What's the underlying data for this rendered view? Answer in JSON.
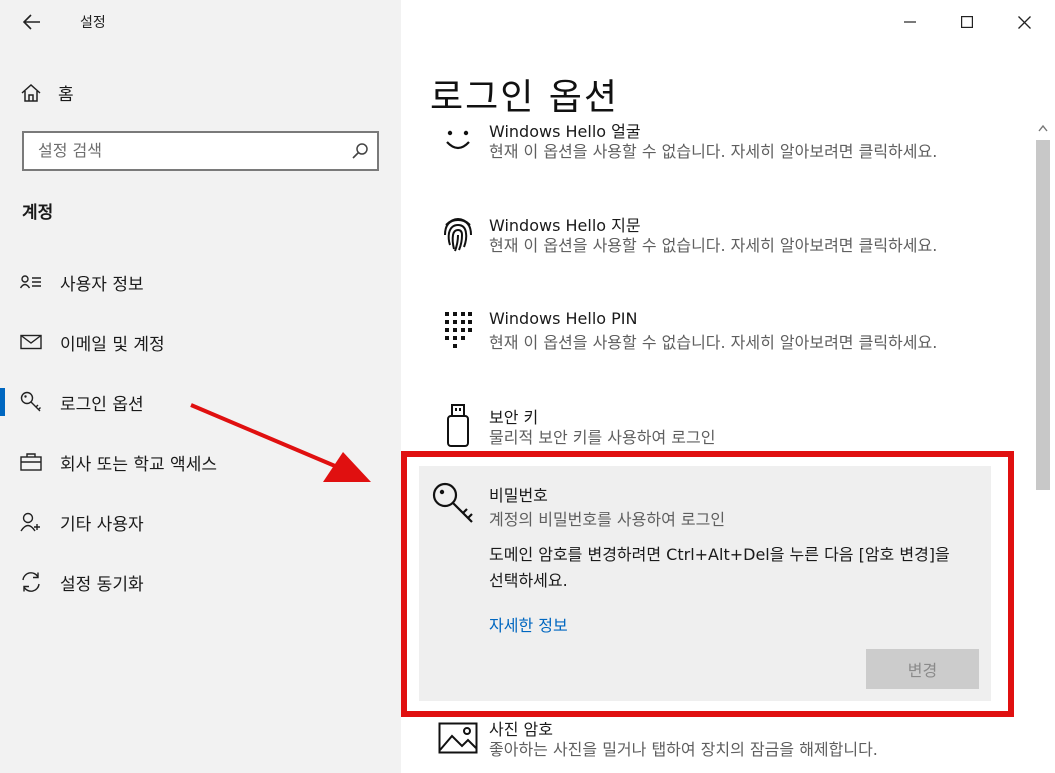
{
  "window": {
    "app_title": "설정"
  },
  "sidebar": {
    "home_label": "홈",
    "search_placeholder": "설정 검색",
    "section_title": "계정",
    "items": [
      {
        "label": "사용자 정보",
        "icon": "user-info-icon"
      },
      {
        "label": "이메일 및 계정",
        "icon": "mail-icon"
      },
      {
        "label": "로그인 옵션",
        "icon": "key-icon",
        "selected": true
      },
      {
        "label": "회사 또는 학교 액세스",
        "icon": "briefcase-icon"
      },
      {
        "label": "기타 사용자",
        "icon": "add-user-icon"
      },
      {
        "label": "설정 동기화",
        "icon": "sync-icon"
      }
    ]
  },
  "main": {
    "page_title": "로그인 옵션",
    "options": [
      {
        "title": "Windows Hello 얼굴",
        "desc": "현재 이 옵션을 사용할 수 없습니다. 자세히 알아보려면 클릭하세요."
      },
      {
        "title": "Windows Hello 지문",
        "desc": "현재 이 옵션을 사용할 수 없습니다. 자세히 알아보려면 클릭하세요."
      },
      {
        "title": "Windows Hello PIN",
        "desc": "현재 이 옵션을 사용할 수 없습니다. 자세히 알아보려면 클릭하세요."
      },
      {
        "title": "보안 키",
        "desc": "물리적 보안 키를 사용하여 로그인"
      }
    ],
    "password": {
      "title": "비밀번호",
      "desc": "계정의 비밀번호를 사용하여 로그인",
      "note": "도메인 암호를 변경하려면 Ctrl+Alt+Del을 누른 다음 [암호 변경]을 선택하세요.",
      "link": "자세한 정보",
      "button": "변경"
    },
    "picture_password": {
      "title": "사진 암호",
      "desc": "좋아하는 사진을 밀거나 탭하여 장치의 잠금을 해제합니다."
    }
  },
  "colors": {
    "accent": "#0067c0",
    "highlight": "#e01010"
  }
}
